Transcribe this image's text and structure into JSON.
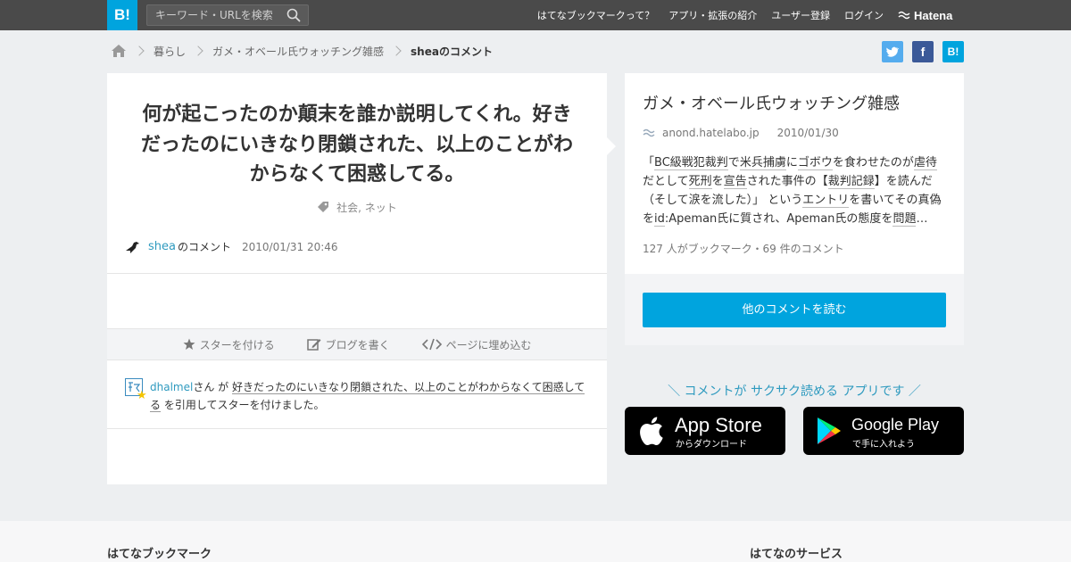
{
  "topbar": {
    "logo": "B!",
    "search_placeholder": "キーワード・URLを検索",
    "nav": [
      "はてなブックマークって？",
      "アプリ・拡張の紹介",
      "ユーザー登録",
      "ログイン"
    ],
    "brand": "Hatena"
  },
  "breadcrumb": {
    "items": [
      "暮らし",
      "ガメ・オベール氏ウォッチング雑感"
    ],
    "current": "sheaのコメント"
  },
  "social": {
    "twitter": "t",
    "facebook": "f",
    "hatebu": "B!"
  },
  "entry": {
    "title": "何が起こったのか顛末を誰か説明してくれ。好きだったのにいきなり閉鎖された、以上のことがわからなくて困惑してる。",
    "tags": "社会, ネット",
    "user": "shea",
    "user_suffix": "のコメント",
    "date": "2010/01/31 20:46"
  },
  "actions": {
    "star": "スターを付ける",
    "blog": "ブログを書く",
    "embed": "ページに埋め込む"
  },
  "quote": {
    "user": "dhalmel",
    "san": "さん が",
    "text": "好きだったのにいきなり閉鎖された、以上のことがわからなくて困惑してる",
    "suffix": "を引用してスターを付けました。"
  },
  "article": {
    "title": "ガメ・オベール氏ウォッチング雑感",
    "domain": "anond.hatelabo.jp",
    "date": "2010/01/30",
    "desc_parts": [
      "「",
      "BC級戦犯裁判",
      "で",
      "米兵捕虜",
      "に",
      "ゴボウ",
      "を食わせたのが",
      "虐待",
      "だとして",
      "死刑",
      "を",
      "宣告",
      "された事件の【",
      "裁判記録",
      "】を読んだ（そして涙を流した）」 という",
      "エントリ",
      "を書いてその真偽を",
      "id",
      ":Apeman氏に質され、Apeman氏の態度を",
      "問題",
      "…"
    ],
    "count": "127 人がブックマーク・69 件のコメント",
    "read_button": "他のコメントを読む"
  },
  "promo": {
    "text": "＼ コメントが サクサク読める アプリです ／",
    "appstore_title": "App Store",
    "appstore_sub": "からダウンロード",
    "google_title": "Google Play",
    "google_sub": "で手に入れよう"
  },
  "footer": {
    "left": "はてなブックマーク",
    "right": "はてなのサービス"
  }
}
